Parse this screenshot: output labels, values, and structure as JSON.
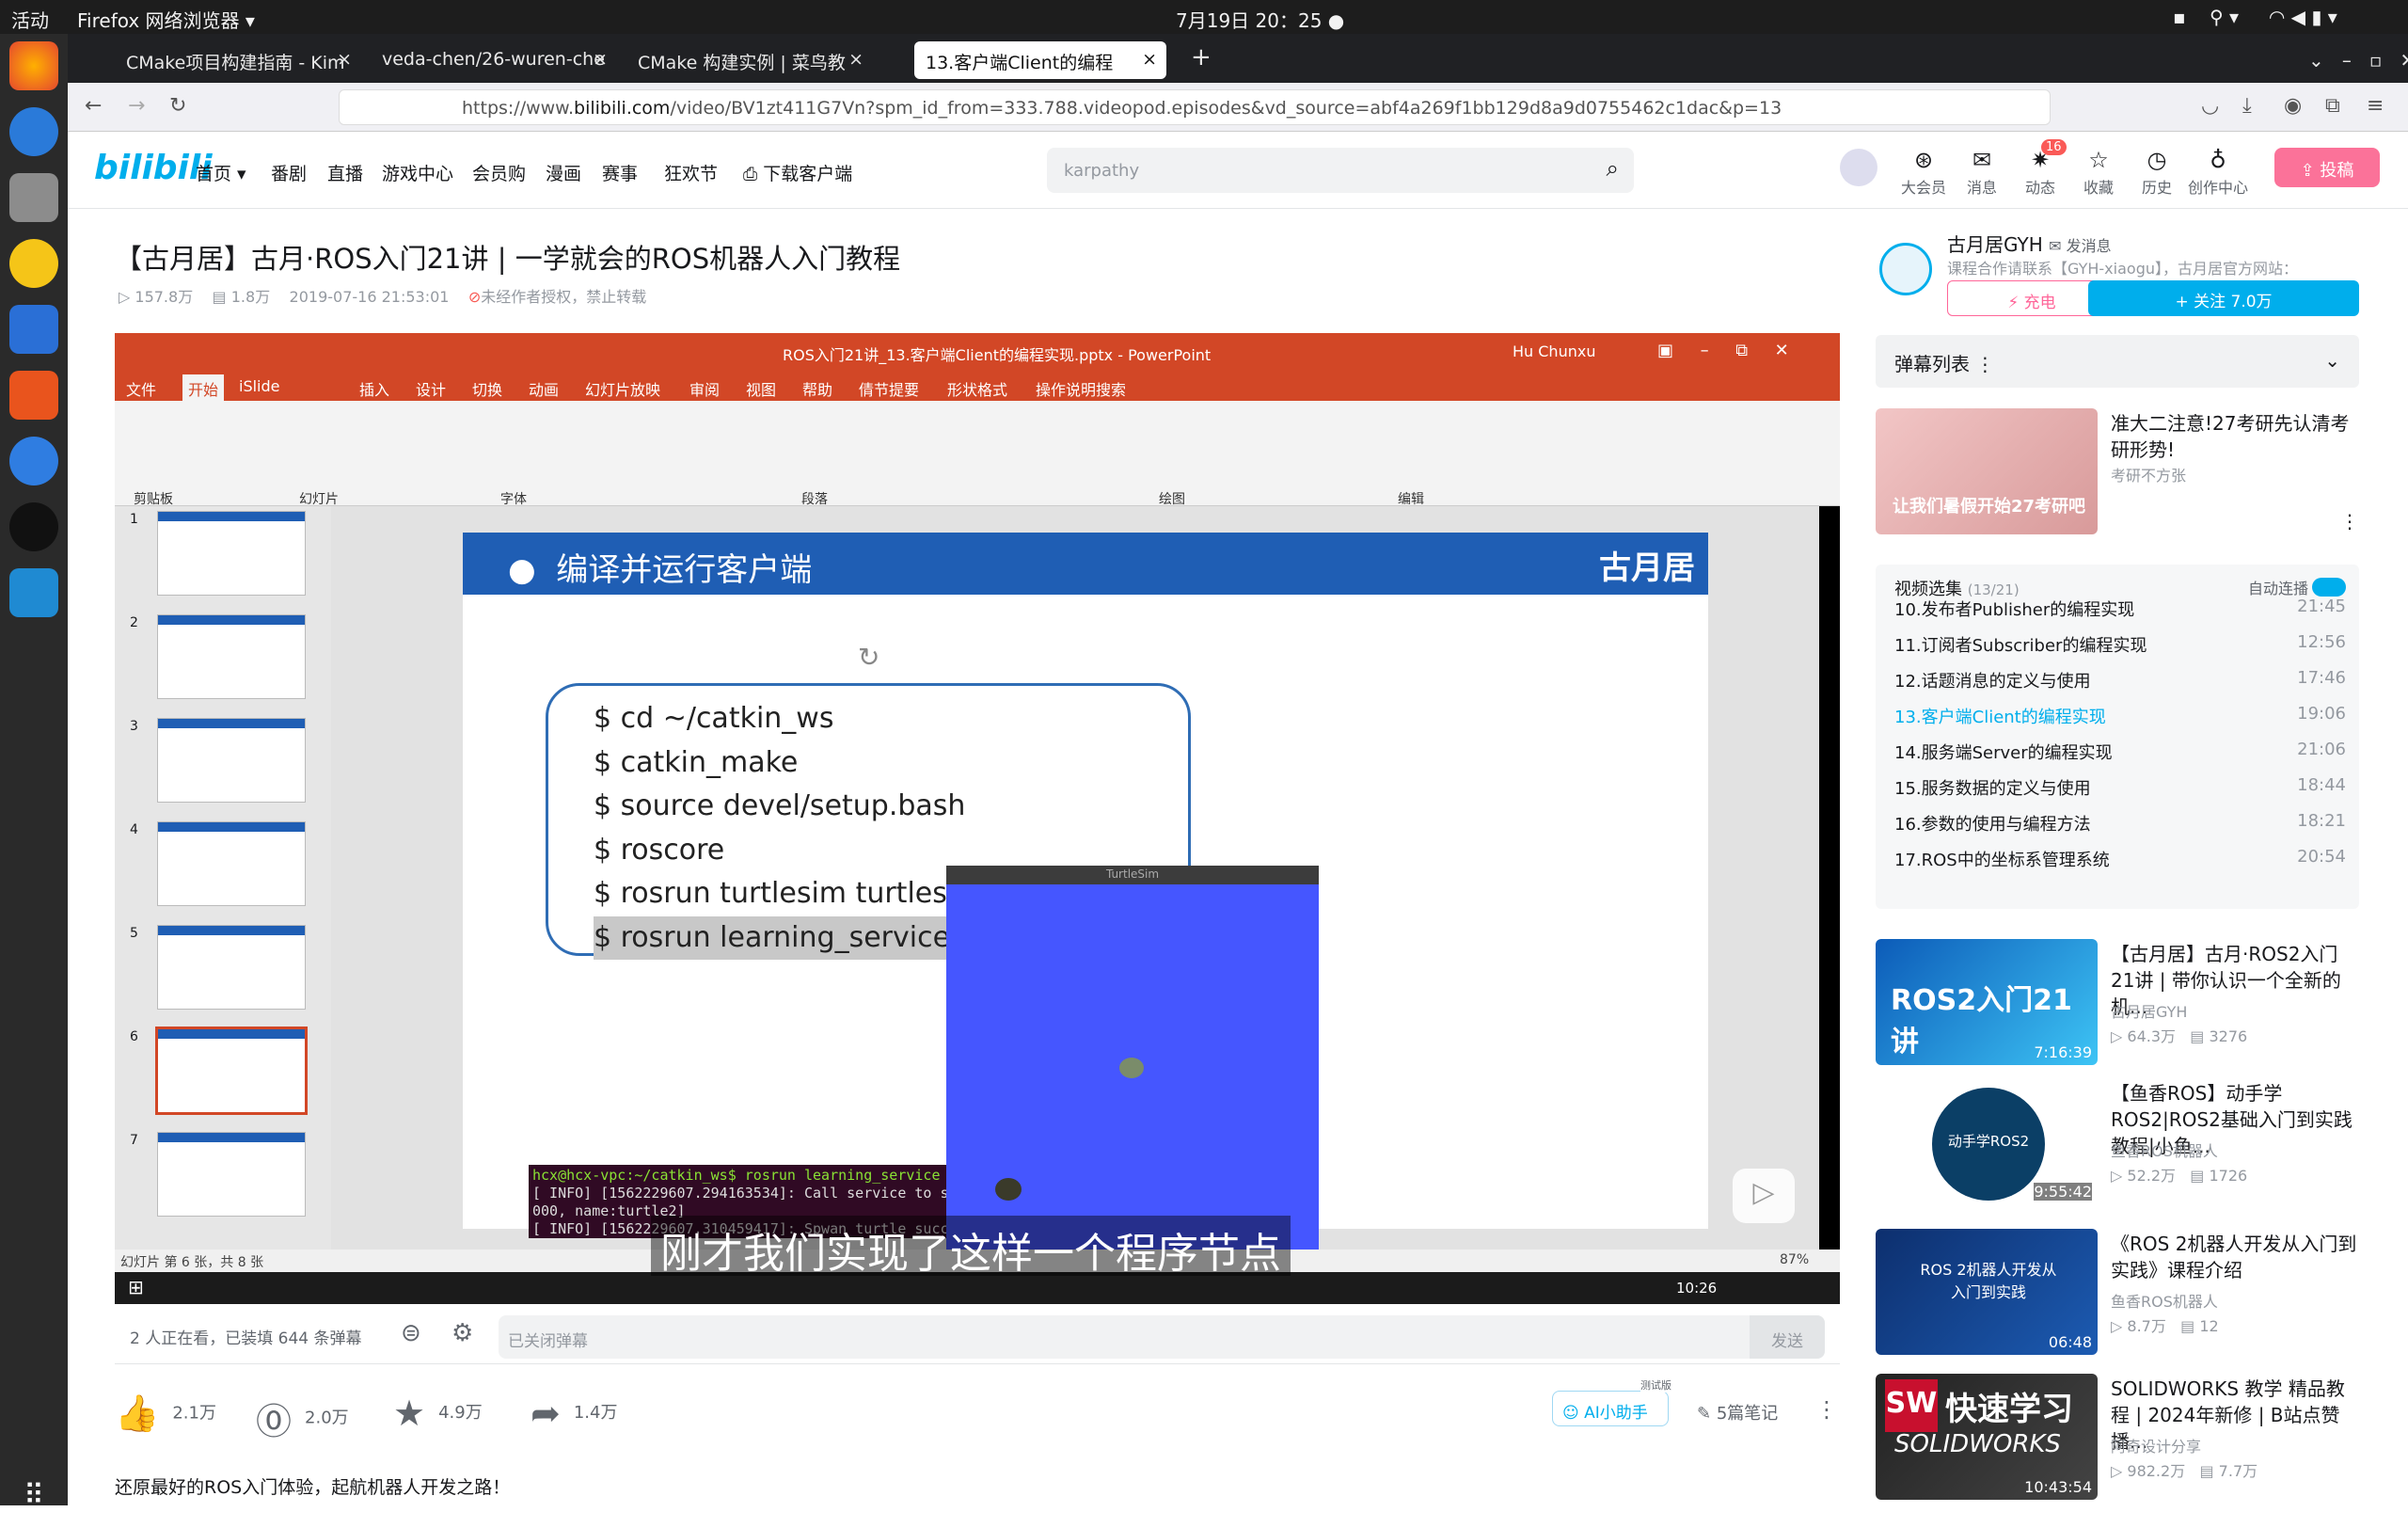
{
  "topbar": {
    "activities": "活动",
    "app": "Firefox 网络浏览器 ▾",
    "datetime": "7月19日  20：25  ●"
  },
  "tabs": [
    {
      "label": "CMake项目构建指南 - Kim"
    },
    {
      "label": "veda-chen/26-wuren-che"
    },
    {
      "label": "CMake 构建实例 | 菜鸟教"
    },
    {
      "label": "13.客户端Client的编程"
    }
  ],
  "url": {
    "prefix": "https://www.",
    "domain": "bilibili.com",
    "rest": "/video/BV1zt411G7Vn?spm_id_from=333.788.videopod.episodes&vd_source=abf4a269f1bb129d8a9d0755462c1dac&p=13"
  },
  "bnav": {
    "home": "首页 ▾",
    "fanju": "番剧",
    "live": "直播",
    "game": "游戏中心",
    "vip": "会员购",
    "manga": "漫画",
    "match": "赛事",
    "carnival": "狂欢节",
    "download": "下载客户端"
  },
  "search": {
    "placeholder": "karpathy"
  },
  "hicons": {
    "vip": "大会员",
    "msg": "消息",
    "dyn": "动态",
    "fav": "收藏",
    "hist": "历史",
    "create": "创作中心",
    "upload": "投稿",
    "dyn_badge": "16"
  },
  "video": {
    "title": "【古月居】古月·ROS入门21讲 | 一学就会的ROS机器人入门教程",
    "plays": "157.8万",
    "danmaku": "1.8万",
    "date": "2019-07-16 21:53:01",
    "copyright": "未经作者授权，禁止转载"
  },
  "ppt": {
    "window_title": "ROS入门21讲_13.客户端Client的编程实现.pptx - PowerPoint",
    "user": "Hu Chunxu",
    "tabs": [
      "文件",
      "开始",
      "iSlide",
      "插入",
      "设计",
      "切换",
      "动画",
      "幻灯片放映",
      "审阅",
      "视图",
      "帮助",
      "倩节提要",
      "形状格式",
      "操作说明搜索"
    ],
    "groups": [
      "剪贴板",
      "幻灯片",
      "字体",
      "段落",
      "绘图",
      "编辑"
    ],
    "slide_heading": "编译并运行客户端",
    "slide_logo": "古月居",
    "code": [
      "$ cd ~/catkin_ws",
      "$ catkin_make",
      "$ source devel/setup.bash",
      "$ roscore",
      "$ rosrun turtlesim turtlesim_node",
      "$ rosrun learning_service turtle_spawn"
    ],
    "terminal": [
      "hcx@hcx-vpc:~/catkin_ws$ rosrun learning_service turtle_spawn",
      "[ INFO] [1562229607.294163534]: Call service to spwan turtle[x:2.000000, y:2.000",
      "000, name:turtle2]",
      "[ INFO] [1562229607.310459417]: Spwan turtle successfully [name:turtle2]"
    ],
    "turtlesim_title": "TurtleSim",
    "status_left": "幻灯片 第 6 张，共 8 张",
    "status_right": "87%",
    "win_time": "10:26",
    "thumbs": [
      "1",
      "2",
      "3",
      "4",
      "5",
      "6",
      "7"
    ]
  },
  "subtitle": "刚才我们实现了这样一个程序节点",
  "dm": {
    "viewers": "2 人正在看，已装填 644 条弹幕",
    "placeholder": "已关闭弹幕",
    "send": "发送"
  },
  "actions": {
    "like": "2.1万",
    "coin": "2.0万",
    "fav": "4.9万",
    "share": "1.4万",
    "ai": "AI小助手",
    "ai_tag": "测试版",
    "notes": "5篇笔记"
  },
  "description": "还原最好的ROS入门体验，起航机器人开发之路！",
  "up": {
    "name": "古月居GYH",
    "msg": "发消息",
    "desc": "课程合作请联系【GYH-xiaogu】，古月居官方网站：",
    "charge": "充电",
    "follow": "+ 关注 7.0万"
  },
  "dmList": "弹幕列表",
  "ad": {
    "title": "准大二注意!27考研先认清考研形势!",
    "author": "考研不方张",
    "thumb": "让我们暑假开始27考研吧"
  },
  "playlist": {
    "title": "视频选集",
    "count": "(13/21)",
    "autoplay": "自动连播",
    "items": [
      {
        "t": "10.发布者Publisher的编程实现",
        "d": "21:45"
      },
      {
        "t": "11.订阅者Subscriber的编程实现",
        "d": "12:56"
      },
      {
        "t": "12.话题消息的定义与使用",
        "d": "17:46"
      },
      {
        "t": "13.客户端Client的编程实现",
        "d": "19:06"
      },
      {
        "t": "14.服务端Server的编程实现",
        "d": "21:06"
      },
      {
        "t": "15.服务数据的定义与使用",
        "d": "18:44"
      },
      {
        "t": "16.参数的使用与编程方法",
        "d": "18:21"
      },
      {
        "t": "17.ROS中的坐标系管理系统",
        "d": "20:54"
      }
    ]
  },
  "recs": [
    {
      "title": "【古月居】古月·ROS2入门21讲 | 带你认识一个全新的机...",
      "author": "古月居GYH",
      "plays": "64.3万",
      "dm": "3276",
      "dur": "7:16:39",
      "thumb": "ROS2入门21讲"
    },
    {
      "title": "【鱼香ROS】动手学ROS2|ROS2基础入门到实践教程|小鱼...",
      "author": "鱼香ROS机器人",
      "plays": "52.2万",
      "dm": "1726",
      "dur": "9:55:42",
      "thumb": "动手学ROS2"
    },
    {
      "title": "《ROS 2机器人开发从入门到实践》课程介绍",
      "author": "鱼香ROS机器人",
      "plays": "8.7万",
      "dm": "12",
      "dur": "06:48",
      "thumb": "ROS 2机器人开发从入门到实践"
    },
    {
      "title": "SOLIDWORKS 教学 精品教程 | 2024年新修 | B站点赞播...",
      "author": "阿奇设计分享",
      "plays": "982.2万",
      "dm": "7.7万",
      "dur": "10:43:54",
      "thumb": "快速学习"
    }
  ]
}
